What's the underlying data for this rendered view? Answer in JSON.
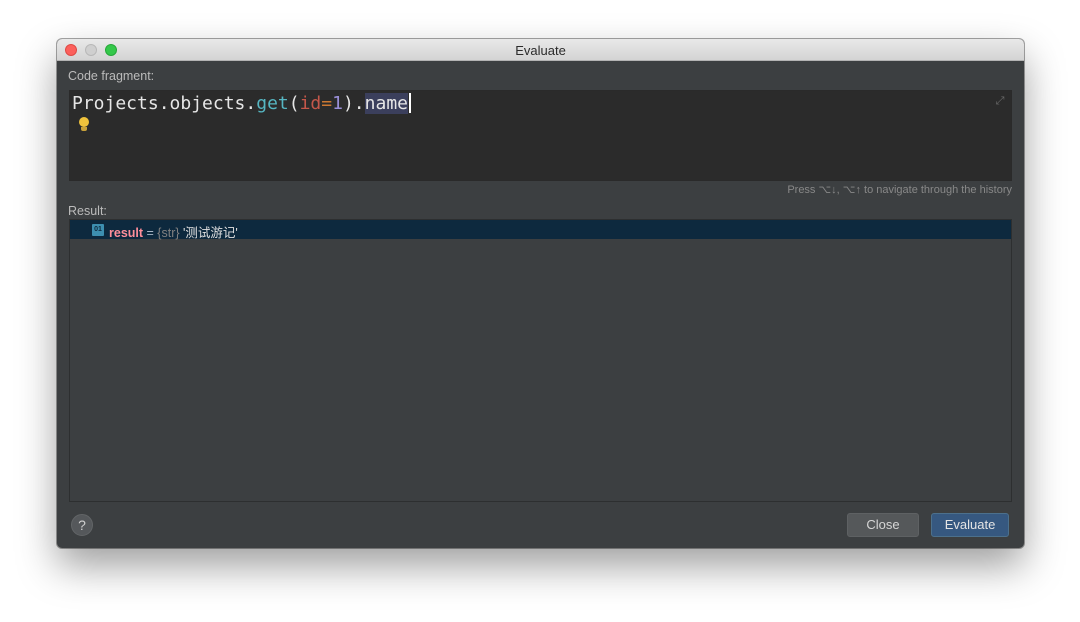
{
  "window": {
    "title": "Evaluate"
  },
  "code_fragment": {
    "label": "Code fragment:",
    "tokens": {
      "object": "Projects.objects.",
      "func": "get",
      "open_paren": "(",
      "param": "id",
      "eq": "=",
      "num": "1",
      "close_paren": ").",
      "attr": "name"
    },
    "history_hint": "Press ⌥↓, ⌥↑ to navigate through the history"
  },
  "result": {
    "label": "Result:",
    "rows": [
      {
        "icon": "01",
        "name": "result",
        "eq": " = ",
        "type": "{str}",
        "value": "'测试游记'"
      }
    ]
  },
  "buttons": {
    "help": "?",
    "close": "Close",
    "evaluate": "Evaluate"
  },
  "colors": {
    "window_bg": "#3c3f41",
    "editor_bg": "#2b2b2b",
    "selection_row": "#0d293e",
    "primary_button": "#365880"
  }
}
